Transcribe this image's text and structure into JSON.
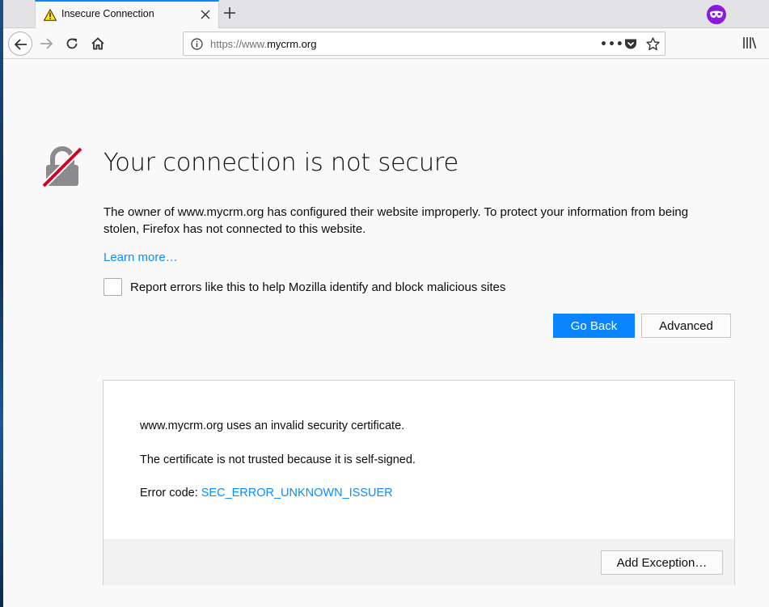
{
  "tab": {
    "title": "Insecure Connection",
    "warning_icon": "warning-triangle-icon"
  },
  "toolbar": {
    "url_prefix": "https://www.",
    "url_host": "mycrm.org",
    "overflow_dots": "•••",
    "icons": [
      "back-icon",
      "forward-icon",
      "reload-icon",
      "home-icon",
      "info-icon",
      "pocket-icon",
      "bookmark-star-icon",
      "library-icon",
      "private-browsing-icon"
    ]
  },
  "error_page": {
    "title": "Your connection is not secure",
    "description": "The owner of www.mycrm.org has configured their website improperly. To protect your information from being stolen, Firefox has not connected to this website.",
    "learn_more": "Learn more…",
    "report_label": "Report errors like this to help Mozilla identify and block malicious sites",
    "report_checked": false,
    "go_back": "Go Back",
    "advanced": "Advanced"
  },
  "advanced_panel": {
    "line1": "www.mycrm.org uses an invalid security certificate.",
    "line2": "The certificate is not trusted because it is self-signed.",
    "error_label": "Error code: ",
    "error_code": "SEC_ERROR_UNKNOWN_ISSUER",
    "add_exception": "Add Exception…"
  },
  "colors": {
    "accent": "#0a84ff",
    "link": "#0a8dff",
    "private": "#8a1bdd",
    "lock_slash": "#d70022"
  }
}
